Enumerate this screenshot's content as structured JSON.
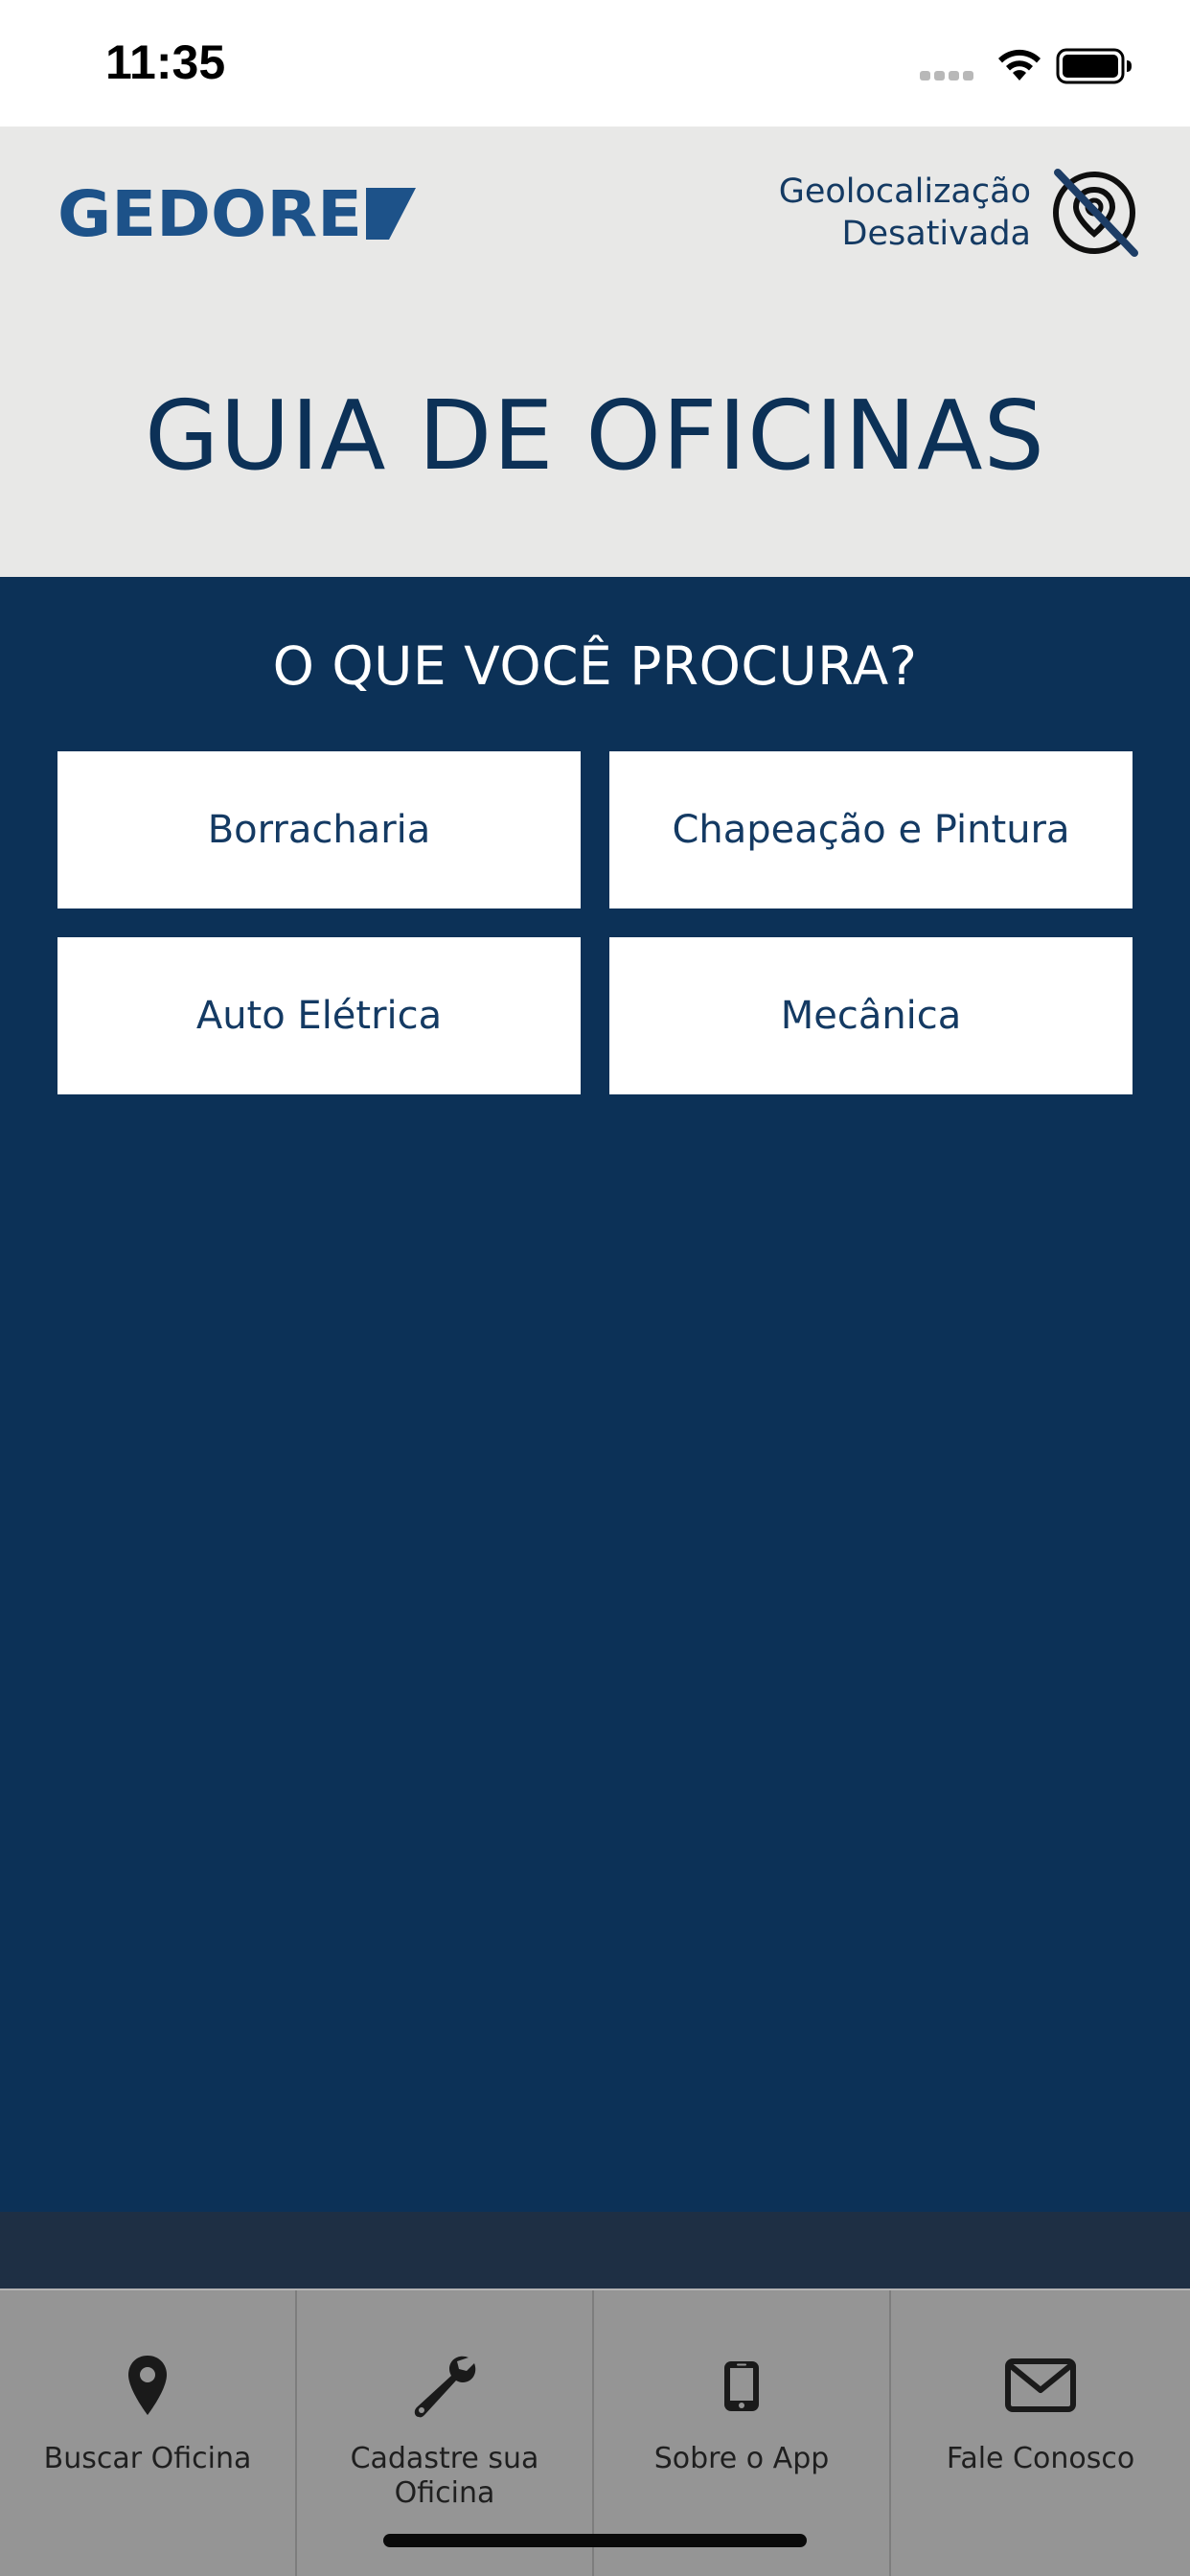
{
  "status_bar": {
    "time": "11:35"
  },
  "header": {
    "logo_text": "GEDORE",
    "geolocation_line1": "Geolocalização",
    "geolocation_line2": "Desativada",
    "geolocation_icon": "location-off-icon",
    "title": "GUIA DE OFICINAS"
  },
  "main": {
    "question": "O QUE VOCÊ PROCURA?",
    "categories": [
      {
        "label": "Borracharia"
      },
      {
        "label": "Chapeação e Pintura"
      },
      {
        "label": "Auto Elétrica"
      },
      {
        "label": "Mecânica"
      }
    ]
  },
  "tabbar": {
    "items": [
      {
        "label": "Buscar Oficina",
        "icon": "map-pin-icon"
      },
      {
        "label": "Cadastre sua Oficina",
        "icon": "wrench-icon"
      },
      {
        "label": "Sobre o App",
        "icon": "phone-icon"
      },
      {
        "label": "Fale Conosco",
        "icon": "envelope-icon"
      }
    ]
  },
  "colors": {
    "brand_blue": "#0c3157",
    "logo_blue": "#1d5289",
    "header_bg": "#e8e8e7",
    "tabbar_bg": "#959595"
  }
}
